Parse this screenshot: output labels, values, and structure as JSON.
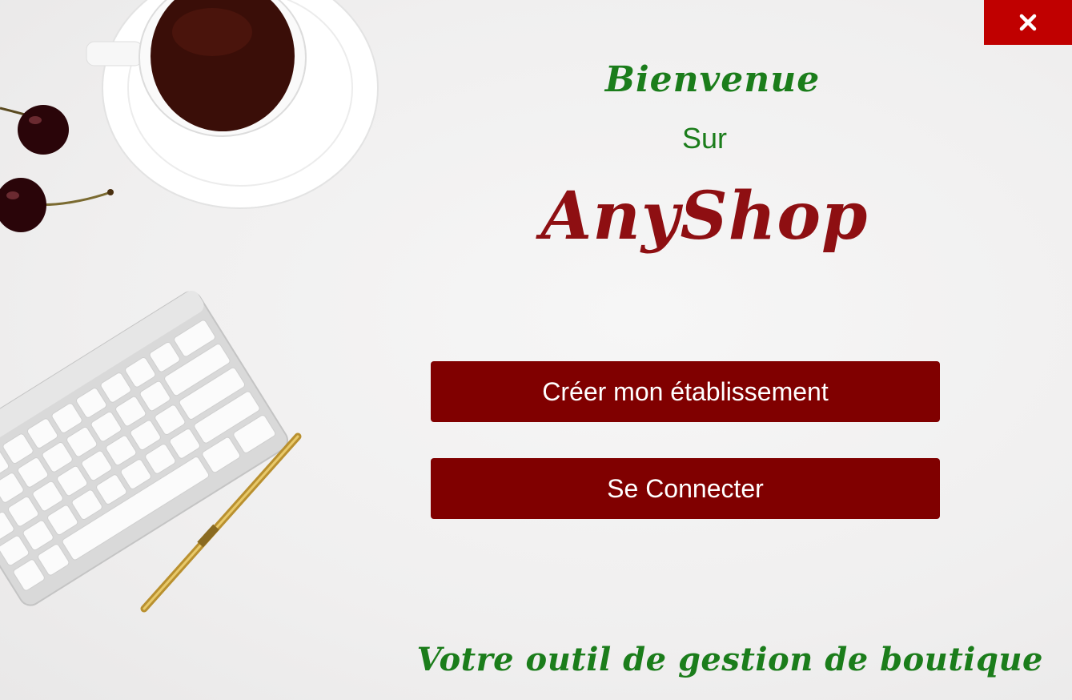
{
  "window": {
    "close_icon": "close-icon",
    "accent_color": "#c00000",
    "button_color": "#800000",
    "heading_green": "#1b7d1b",
    "brand_red": "#8e0f12"
  },
  "welcome": {
    "title": "Bienvenue",
    "subtitle": "Sur",
    "brand": "AnyShop"
  },
  "actions": {
    "create_label": "Créer mon établissement",
    "connect_label": "Se Connecter"
  },
  "footer": {
    "tagline": "Votre outil de gestion de boutique"
  },
  "decor": {
    "image": "desk-with-coffee-cherries-keyboard-pen"
  }
}
